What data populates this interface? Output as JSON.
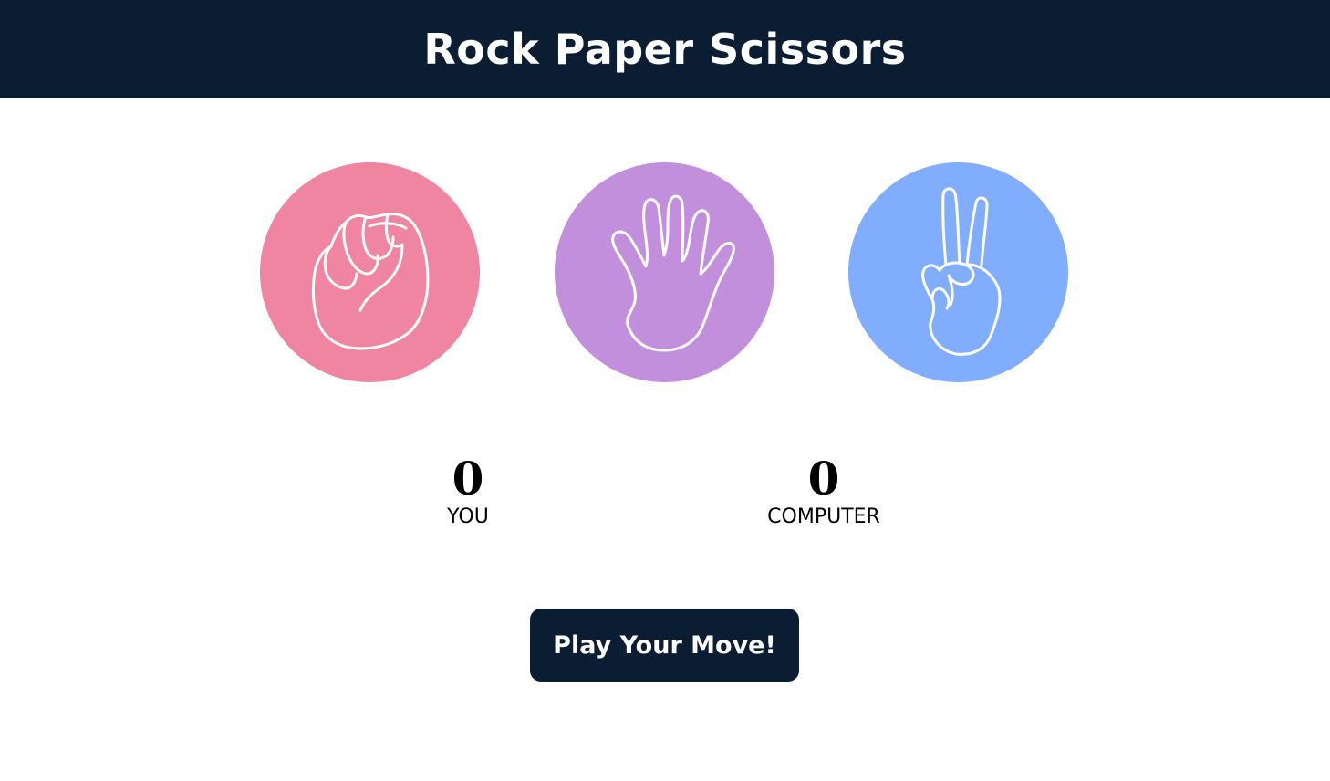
{
  "header": {
    "title": "Rock Paper Scissors"
  },
  "choices": [
    {
      "name": "rock",
      "icon": "fist-icon",
      "color": "#f085a2"
    },
    {
      "name": "paper",
      "icon": "open-hand-icon",
      "color": "#c28fdd"
    },
    {
      "name": "scissors",
      "icon": "peace-sign-hand-icon",
      "color": "#81adff"
    }
  ],
  "scoreboard": {
    "you": {
      "score": "0",
      "label": "YOU"
    },
    "computer": {
      "score": "0",
      "label": "COMPUTER"
    }
  },
  "play_button": {
    "label": "Play Your Move!"
  },
  "colors": {
    "header_bg": "#0b1d33",
    "button_bg": "#0b1d33"
  }
}
